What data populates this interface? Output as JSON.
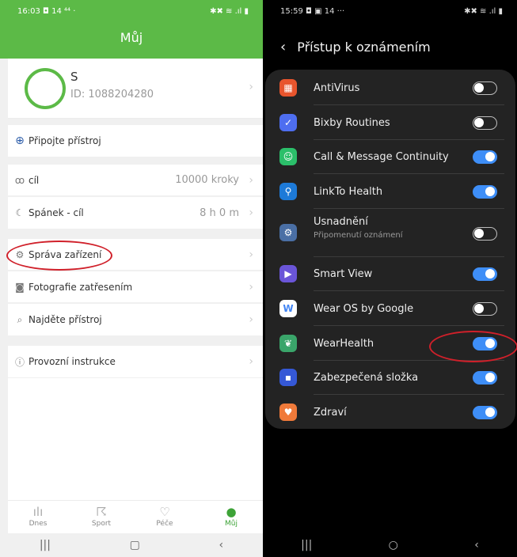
{
  "left": {
    "status": {
      "time": "16:03",
      "icons_left": "◘ 14 ⁴⁴ ·",
      "icons_right": "✱✖ ≋ .ıl ▮"
    },
    "header_title": "Můj",
    "profile": {
      "name": "S",
      "id": "ID: 1088204280"
    },
    "connect_label": "Připojte přístroj",
    "goal": {
      "label": "cíl",
      "value": "10000 kroky"
    },
    "sleep": {
      "label": "Spánek - cíl",
      "value": "8 h 0 m"
    },
    "device_mgmt_label": "Správa zařízení",
    "photo_label": "Fotografie zatřesením",
    "find_label": "Najděte přístroj",
    "instructions_label": "Provozní instrukce",
    "nav": [
      {
        "label": "Dnes",
        "icon": "bars-chart-icon"
      },
      {
        "label": "Sport",
        "icon": "running-icon"
      },
      {
        "label": "Péče",
        "icon": "heart-plus-icon"
      },
      {
        "label": "Můj",
        "icon": "person-icon"
      }
    ],
    "accent": "#5cba47"
  },
  "right": {
    "status": {
      "time": "15:59",
      "icons_left": "◘ ▣ 14 ···",
      "icons_right": "✱✖ ≋ .ıl ▮"
    },
    "title": "Přístup k oznámením",
    "apps": [
      {
        "name": "AntiVirus",
        "enabled": false,
        "color": "#e8552d",
        "icon": "antivirus-icon"
      },
      {
        "name": "Bixby Routines",
        "enabled": false,
        "color": "#4e6ef0",
        "icon": "bixby-routines-icon"
      },
      {
        "name": "Call & Message Continuity",
        "enabled": true,
        "color": "#2bbf6a",
        "icon": "call-continuity-icon"
      },
      {
        "name": "LinkTo Health",
        "enabled": true,
        "color": "#1d7ad8",
        "icon": "linkto-health-icon"
      },
      {
        "name": "Usnadnění",
        "sub": "Připomenutí oznámení",
        "enabled": false,
        "color": "#4a6fa5",
        "icon": "accessibility-gear-icon"
      },
      {
        "name": "Smart View",
        "enabled": true,
        "color": "#6a55d8",
        "icon": "smart-view-icon"
      },
      {
        "name": "Wear OS by Google",
        "enabled": false,
        "color": "#ffffff",
        "icon": "wear-os-icon"
      },
      {
        "name": "WearHealth",
        "enabled": true,
        "color": "#3aa56a",
        "icon": "wearhealth-icon"
      },
      {
        "name": "Zabezpečená složka",
        "enabled": true,
        "color": "#3558d6",
        "icon": "secure-folder-icon"
      },
      {
        "name": "Zdraví",
        "enabled": true,
        "color": "#f07a3a",
        "icon": "health-heart-icon"
      }
    ],
    "toggle_on_color": "#3e8ef7"
  },
  "annotation_color": "#d0202a"
}
